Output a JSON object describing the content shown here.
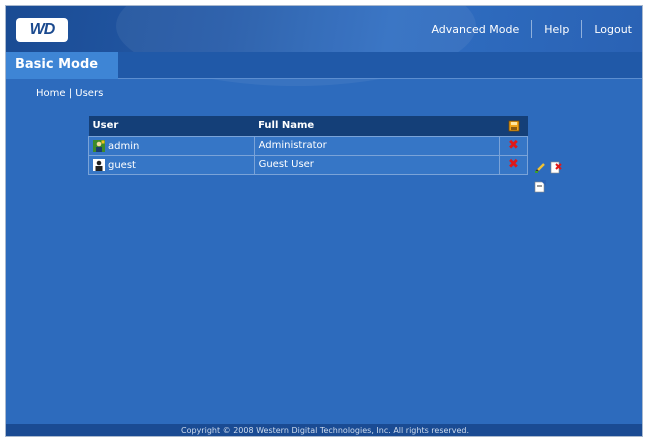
{
  "header": {
    "logo_text": "WD",
    "nav": {
      "advanced_mode": "Advanced Mode",
      "help": "Help",
      "logout": "Logout"
    }
  },
  "tab": {
    "label": "Basic Mode"
  },
  "breadcrumb": {
    "home": "Home",
    "separator": "|",
    "current": "Users"
  },
  "table": {
    "columns": {
      "user": "User",
      "full_name": "Full Name"
    },
    "header_icon": "users-save-icon",
    "rows": [
      {
        "user": "admin",
        "full_name": "Administrator",
        "icon": "admin-user-icon",
        "delete_icon": "delete-x-icon"
      },
      {
        "user": "guest",
        "full_name": "Guest User",
        "icon": "guest-user-icon",
        "delete_icon": "delete-x-icon"
      }
    ]
  },
  "side_actions": [
    "edit-pencil-icon",
    "delete-user-icon",
    "add-user-icon"
  ],
  "colors": {
    "background": "#2d6bbd",
    "header": "#1a4b93",
    "table_header": "#143f78",
    "delete": "#e01818"
  },
  "footer": {
    "copyright": "Copyright © 2008 Western Digital Technologies, Inc. All rights reserved."
  }
}
